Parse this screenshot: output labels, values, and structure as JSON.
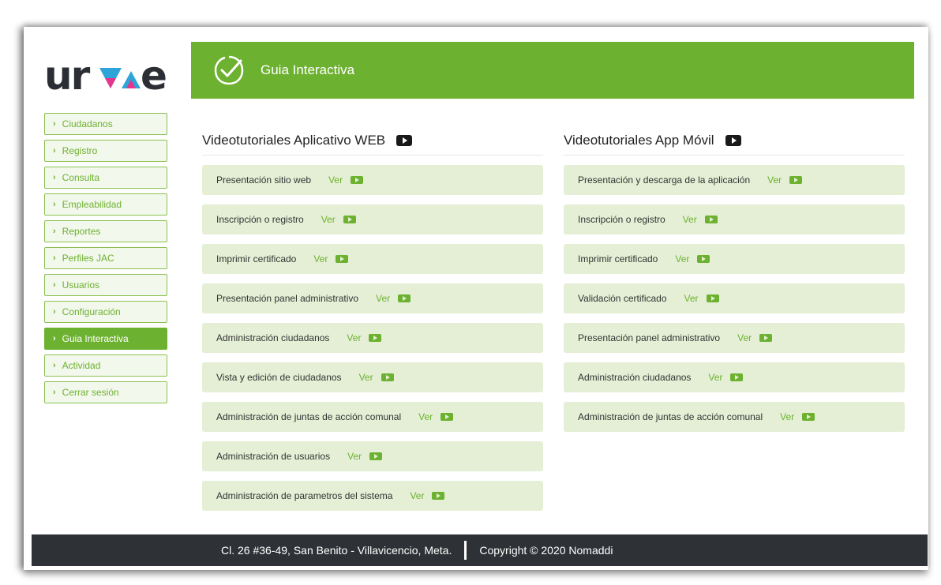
{
  "logo": {
    "text": "urve"
  },
  "header": {
    "title": "Guia Interactiva",
    "icon": "check-badge-icon"
  },
  "colors": {
    "brand_green": "#6db130",
    "row_bg": "#e4efd5",
    "footer_bg": "#2e3236"
  },
  "sidebar": {
    "items": [
      {
        "label": "Ciudadanos",
        "active": false
      },
      {
        "label": "Registro",
        "active": false
      },
      {
        "label": "Consulta",
        "active": false
      },
      {
        "label": "Empleabilidad",
        "active": false
      },
      {
        "label": "Reportes",
        "active": false
      },
      {
        "label": "Perfiles JAC",
        "active": false
      },
      {
        "label": "Usuarios",
        "active": false
      },
      {
        "label": "Configuración",
        "active": false
      },
      {
        "label": "Guia Interactiva",
        "active": true
      },
      {
        "label": "Actividad",
        "active": false
      },
      {
        "label": "Cerrar sesión",
        "active": false
      }
    ]
  },
  "web": {
    "title": "Videotutoriales Aplicativo WEB",
    "items": [
      {
        "label": "Presentación sitio web",
        "link": "Ver"
      },
      {
        "label": "Inscripción o registro",
        "link": "Ver"
      },
      {
        "label": "Imprimir certificado",
        "link": "Ver"
      },
      {
        "label": "Presentación panel administrativo",
        "link": "Ver"
      },
      {
        "label": "Administración ciudadanos",
        "link": "Ver"
      },
      {
        "label": "Vista y edición de ciudadanos",
        "link": "Ver"
      },
      {
        "label": "Administración de juntas de acción comunal",
        "link": "Ver"
      },
      {
        "label": "Administración de usuarios",
        "link": "Ver"
      },
      {
        "label": "Administración de parametros del sistema",
        "link": "Ver"
      }
    ]
  },
  "app": {
    "title": "Videotutoriales App Móvil",
    "items": [
      {
        "label": "Presentación y descarga de la aplicación",
        "link": "Ver"
      },
      {
        "label": "Inscripción o registro",
        "link": "Ver"
      },
      {
        "label": "Imprimir certificado",
        "link": "Ver"
      },
      {
        "label": "Validación certificado",
        "link": "Ver"
      },
      {
        "label": "Presentación panel administrativo",
        "link": "Ver"
      },
      {
        "label": "Administración ciudadanos",
        "link": "Ver"
      },
      {
        "label": "Administración de juntas de acción comunal",
        "link": "Ver"
      }
    ]
  },
  "footer": {
    "address": "Cl. 26 #36-49, San Benito - Villavicencio, Meta.",
    "copyright": "Copyright © 2020 Nomaddi"
  }
}
